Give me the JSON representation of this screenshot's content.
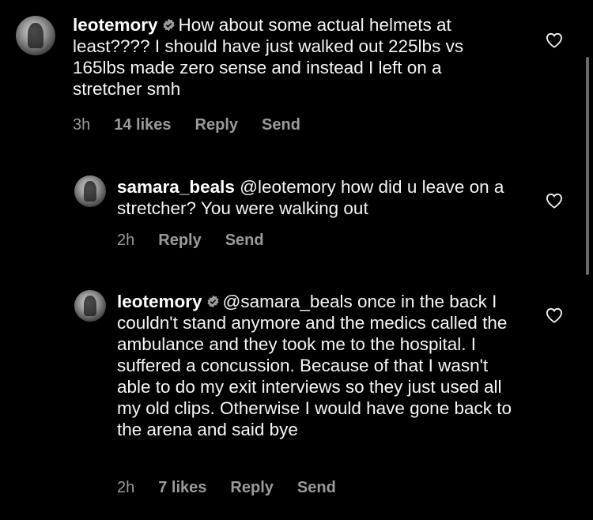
{
  "comments": [
    {
      "username": "leotemory",
      "verified": true,
      "text": "How about some actual helmets at least???? I should have just walked out 225lbs vs 165lbs made zero sense and instead I left on a stretcher smh",
      "time": "3h",
      "likes": "14 likes",
      "reply": "Reply",
      "send": "Send"
    },
    {
      "username": "samara_beals",
      "verified": false,
      "text": "@leotemory how did u leave on a stretcher? You were walking out",
      "time": "2h",
      "likes": "",
      "reply": "Reply",
      "send": "Send"
    },
    {
      "username": "leotemory",
      "verified": true,
      "text": "@samara_beals once in the back I couldn't stand anymore and the medics called the ambulance and they took me to the hospital. I suffered a concussion. Because of that I wasn't able to do my exit interviews so they just used all my old clips. Otherwise I would have gone back to the arena and said bye",
      "time": "2h",
      "likes": "7 likes",
      "reply": "Reply",
      "send": "Send"
    }
  ],
  "icons": {
    "heart": "heart-outline-icon",
    "verified": "verified-badge-icon"
  },
  "colors": {
    "background": "#000000",
    "text": "#f5f5f5",
    "meta": "#9a9a9a"
  }
}
